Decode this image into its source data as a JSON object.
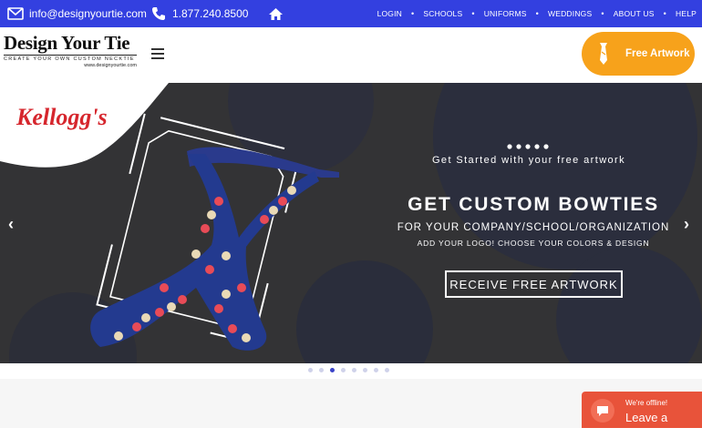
{
  "topbar": {
    "email": "info@designyourtie.com",
    "phone": "1.877.240.8500",
    "nav": [
      "LOGIN",
      "SCHOOLS",
      "UNIFORMS",
      "WEDDINGS",
      "ABOUT US",
      "HELP"
    ],
    "icons": [
      "mail-icon",
      "phone-icon",
      "home-icon"
    ]
  },
  "header": {
    "logo_name": "Design Your Tie",
    "logo_tagline": "CREATE YOUR OWN CUSTOM NECKTIE",
    "logo_site": "www.designyourtie.com",
    "cta_label": "Free Artwork"
  },
  "hero": {
    "brand": "Kellogg's",
    "subheading": "Get Started with your free artwork",
    "heading": "GET CUSTOM BOWTIES",
    "line1": "FOR YOUR COMPANY/SCHOOL/ORGANIZATION",
    "line2": "ADD YOUR LOGO! CHOOSE YOUR COLORS & DESIGN",
    "button": "RECEIVE FREE ARTWORK",
    "prev_arrow": "‹",
    "next_arrow": "›",
    "slide_count": 8,
    "active_slide": 3
  },
  "chat": {
    "status": "We're offline!",
    "label": "Leave a mes..."
  },
  "colors": {
    "topbar": "#3340e0",
    "accent": "#f7a21b",
    "hero_bg": "#333335",
    "chat": "#e8533a"
  }
}
